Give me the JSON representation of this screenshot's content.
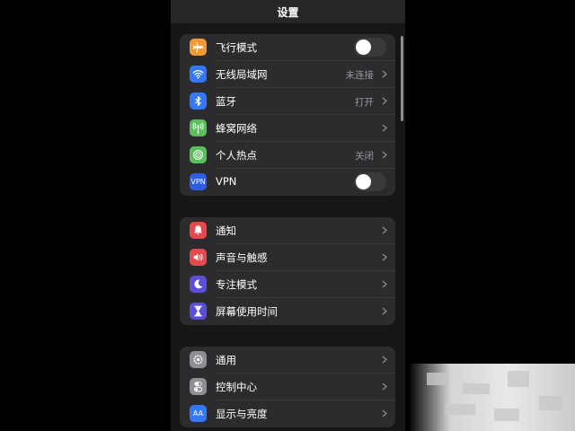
{
  "header": {
    "title": "设置"
  },
  "groups": [
    {
      "items": [
        {
          "label": "飞行模式",
          "icon": "airplane-icon",
          "color": "#f09a37"
        },
        {
          "label": "无线局域网",
          "icon": "wifi-icon",
          "color": "#3478f6",
          "value": "未连接"
        },
        {
          "label": "蓝牙",
          "icon": "bluetooth-icon",
          "color": "#3478f6",
          "value": "打开"
        },
        {
          "label": "蜂窝网络",
          "icon": "cellular-antenna-icon",
          "color": "#5ac05b"
        },
        {
          "label": "个人热点",
          "icon": "hotspot-icon",
          "color": "#5ac05b",
          "value": "关闭"
        },
        {
          "label": "VPN",
          "icon": "vpn-icon",
          "color": "#2f5fe0",
          "icon_text": "VPN"
        }
      ]
    },
    {
      "items": [
        {
          "label": "通知",
          "icon": "bell-icon",
          "color": "#e5484d"
        },
        {
          "label": "声音与触感",
          "icon": "speaker-icon",
          "color": "#e5484d"
        },
        {
          "label": "专注模式",
          "icon": "moon-icon",
          "color": "#5b4fd6"
        },
        {
          "label": "屏幕使用时间",
          "icon": "hourglass-icon",
          "color": "#5b4fd6"
        }
      ]
    },
    {
      "items": [
        {
          "label": "通用",
          "icon": "gear-icon",
          "color": "#8e8e93"
        },
        {
          "label": "控制中心",
          "icon": "toggles-icon",
          "color": "#8e8e93"
        },
        {
          "label": "显示与亮度",
          "icon": "text-size-icon",
          "color": "#3478f6",
          "icon_text": "AA"
        }
      ]
    }
  ],
  "toggles": {
    "airplane_mode_on": false,
    "vpn_on": false
  }
}
